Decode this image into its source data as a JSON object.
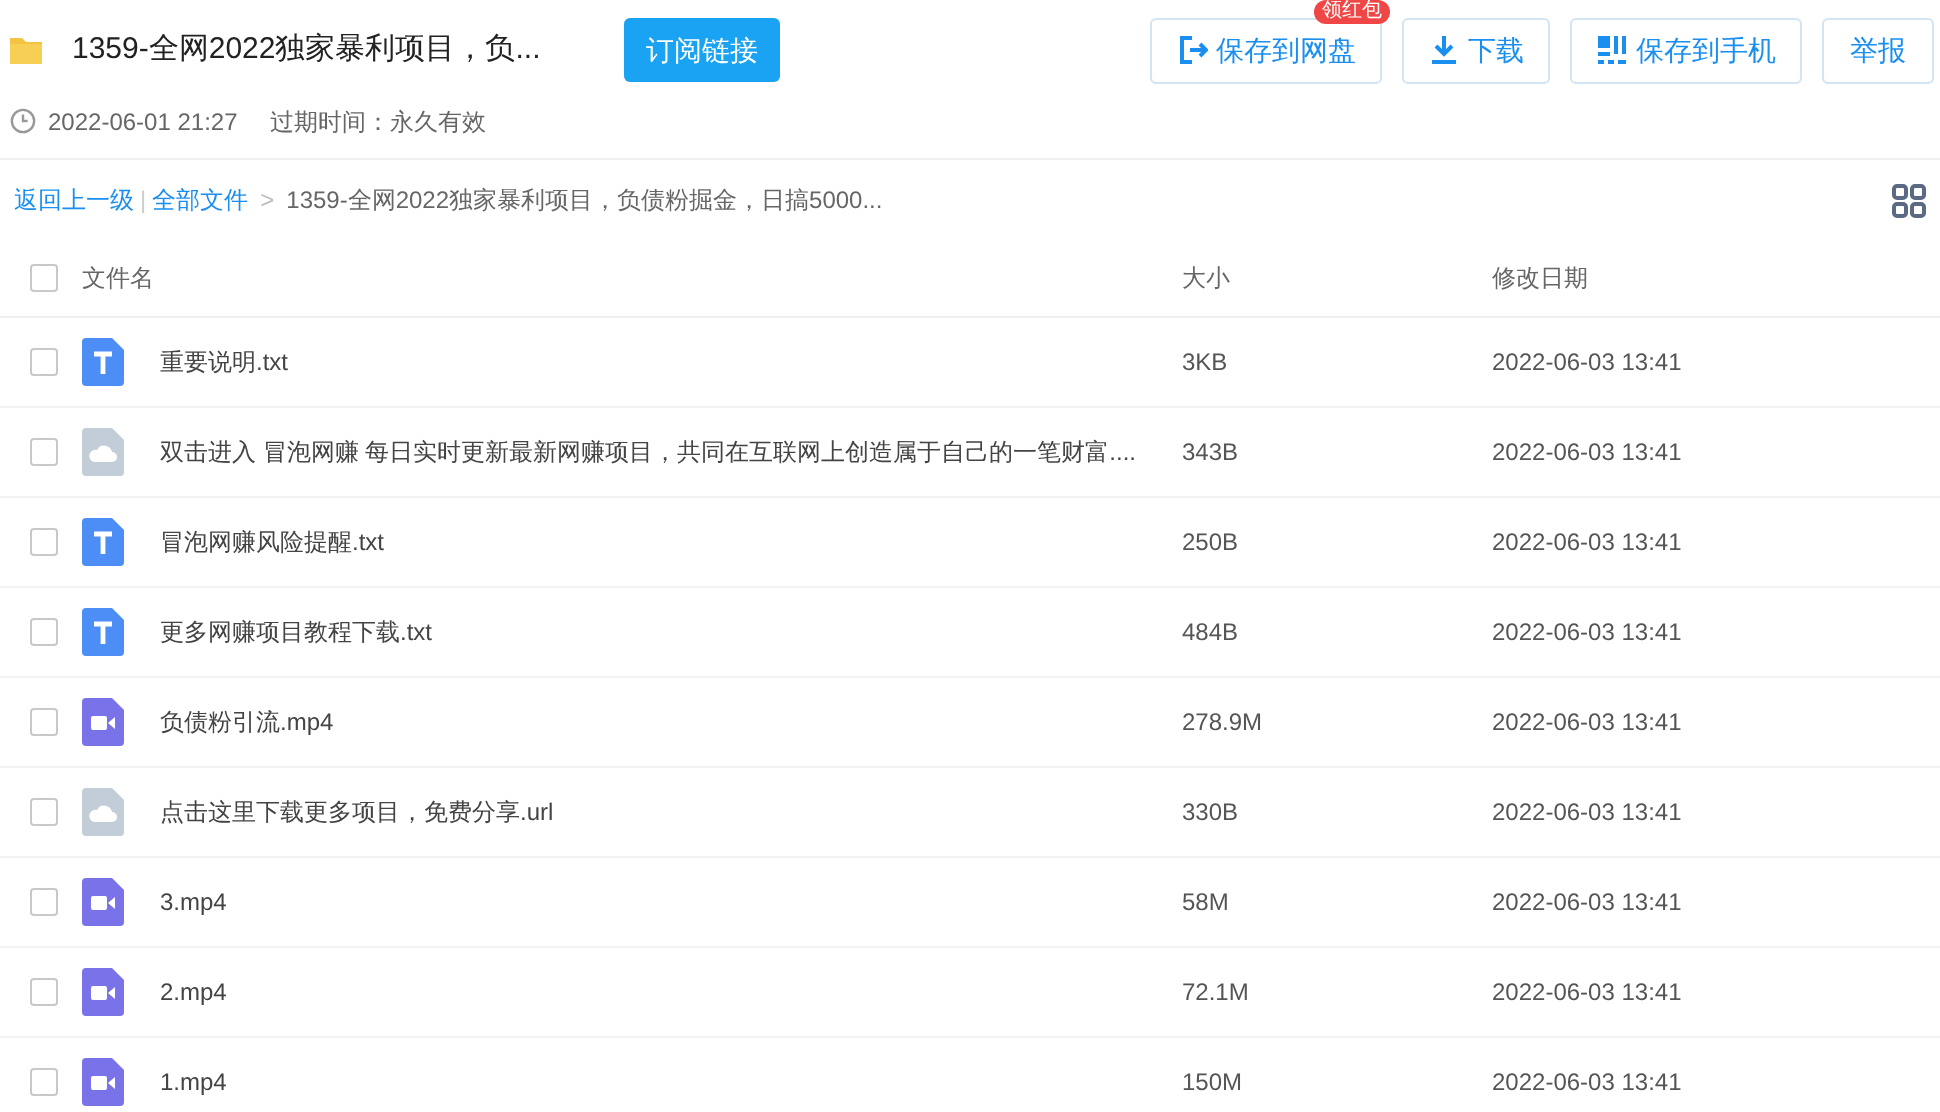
{
  "header": {
    "title": "1359-全网2022独家暴利项目，负...",
    "subscribe_button": "订阅链接",
    "actions": [
      {
        "kind": "save",
        "label": "保存到网盘",
        "badge": "领红包"
      },
      {
        "kind": "download",
        "label": "下载"
      },
      {
        "kind": "phone",
        "label": "保存到手机"
      },
      {
        "kind": "report",
        "label": "举报"
      }
    ]
  },
  "meta": {
    "created": "2022-06-01 21:27",
    "expiry": "过期时间：永久有效"
  },
  "breadcrumb": {
    "back": "返回上一级",
    "separator": "|",
    "root": "全部文件",
    "arrow": ">",
    "current": "1359-全网2022独家暴利项目，负债粉掘金，日搞5000..."
  },
  "table": {
    "columns": [
      "文件名",
      "大小",
      "修改日期"
    ],
    "select_all_checked": false,
    "rows": [
      {
        "kind": "text",
        "name": "重要说明.txt",
        "size": "3KB",
        "date": "2022-06-03 13:41",
        "checked": false
      },
      {
        "kind": "other",
        "name": "双击进入 冒泡网赚 每日实时更新最新网赚项目，共同在互联网上创造属于自己的一笔财富....",
        "size": "343B",
        "date": "2022-06-03 13:41",
        "checked": false
      },
      {
        "kind": "text",
        "name": "冒泡网赚风险提醒.txt",
        "size": "250B",
        "date": "2022-06-03 13:41",
        "checked": false
      },
      {
        "kind": "text",
        "name": "更多网赚项目教程下载.txt",
        "size": "484B",
        "date": "2022-06-03 13:41",
        "checked": false
      },
      {
        "kind": "video",
        "name": "负债粉引流.mp4",
        "size": "278.9M",
        "date": "2022-06-03 13:41",
        "checked": false
      },
      {
        "kind": "other",
        "name": "点击这里下载更多项目，免费分享.url",
        "size": "330B",
        "date": "2022-06-03 13:41",
        "checked": false
      },
      {
        "kind": "video",
        "name": "3.mp4",
        "size": "58M",
        "date": "2022-06-03 13:41",
        "checked": false
      },
      {
        "kind": "video",
        "name": "2.mp4",
        "size": "72.1M",
        "date": "2022-06-03 13:41",
        "checked": false
      },
      {
        "kind": "video",
        "name": "1.mp4",
        "size": "150M",
        "date": "2022-06-03 13:41",
        "checked": false
      }
    ]
  }
}
